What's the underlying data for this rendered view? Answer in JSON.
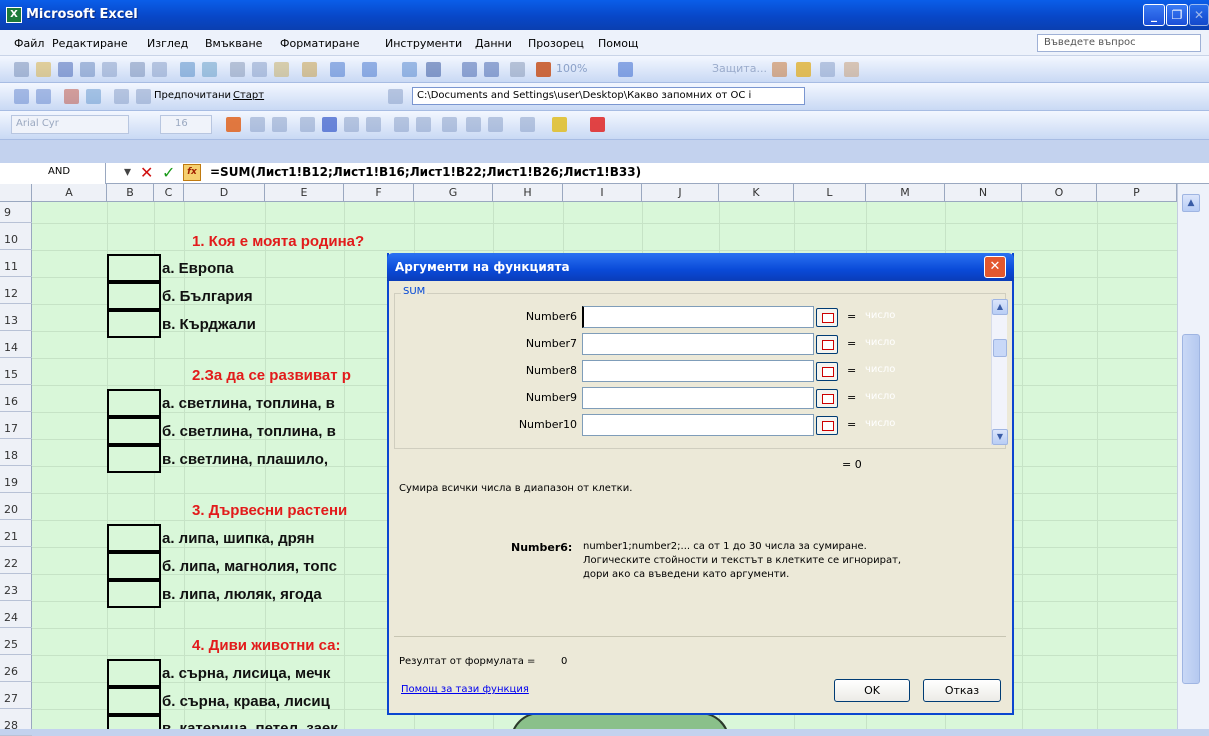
{
  "window": {
    "title": "Microsoft Excel",
    "app_icon": "excel-icon"
  },
  "menu": [
    "Файл",
    "Редактиране",
    "Изглед",
    "Вмъкване",
    "Форматиране",
    "Инструменти",
    "Данни",
    "Прозорец",
    "Помощ"
  ],
  "help_box_placeholder": "Въведете въпрос",
  "toolbar": {
    "zoom": "100%",
    "protect": "Защита...",
    "favorites": "Предпочитани",
    "start": "Старт",
    "path": "C:\\Documents and Settings\\user\\Desktop\\Какво запомних от ОС і",
    "font": "Arial Cyr",
    "font_size": "16"
  },
  "formula_bar": {
    "name_box": "AND",
    "formula": "=SUM(Лист1!B12;Лист1!B16;Лист1!B22;Лист1!B26;Лист1!B33)"
  },
  "columns": [
    "A",
    "B",
    "C",
    "D",
    "E",
    "F",
    "G",
    "H",
    "I",
    "J",
    "K",
    "L",
    "M",
    "N",
    "O",
    "P"
  ],
  "rows": [
    "9",
    "10",
    "11",
    "12",
    "13",
    "14",
    "15",
    "16",
    "17",
    "18",
    "19",
    "20",
    "21",
    "22",
    "23",
    "24",
    "25",
    "26",
    "27",
    "28"
  ],
  "sheet": {
    "q1": "1. Коя е моята родина?",
    "q1a": "а. Европа",
    "q1b": "б. България",
    "q1c": "в. Кърджали",
    "q2": "2.За да се развиват р",
    "q2a": "а. светлина, топлина, в",
    "q2b": "б. светлина, топлина, в",
    "q2c": "в. светлина, плашило,",
    "q3": "3. Дървесни растени",
    "q3a": "а. липа, шипка, дрян",
    "q3b": "б. липа, магнолия, топс",
    "q3c": "в. липа, люляк, ягода",
    "q4": "4. Диви животни са:",
    "q4a": "а. сърна, лисица, мечк",
    "q4b": "б. сърна, крава, лисиц",
    "q4c": "в. катерица, петел, заек"
  },
  "dialog": {
    "title": "Аргументи на функцията",
    "function": "SUM",
    "args": [
      {
        "label": "Number6",
        "value": "",
        "result": "число"
      },
      {
        "label": "Number7",
        "value": "",
        "result": "число"
      },
      {
        "label": "Number8",
        "value": "",
        "result": "число"
      },
      {
        "label": "Number9",
        "value": "",
        "result": "число"
      },
      {
        "label": "Number10",
        "value": "",
        "result": "число"
      }
    ],
    "total": "= 0",
    "description": "Сумира всички числа в диапазон от клетки.",
    "arg_name": "Number6:",
    "arg_help": [
      "number1;number2;... са от 1 до 30 числа за сумиране.",
      "Логическите стойности и текстът в клетките се игнорират,",
      "дори ако са въведени като аргументи."
    ],
    "result_label": "Резултат от формулата =",
    "result_value": "0",
    "help_link": "Помощ за тази функция",
    "ok": "OK",
    "cancel": "Отказ"
  }
}
